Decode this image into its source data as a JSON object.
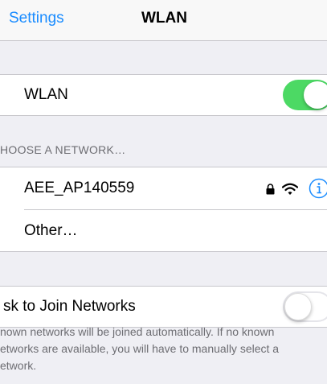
{
  "navbar": {
    "back_label": "Settings",
    "title": "WLAN"
  },
  "wlan_row": {
    "label": "WLAN",
    "toggle_on": true
  },
  "networks_section": {
    "header": "HOOSE A NETWORK…",
    "networks": [
      {
        "name": "AEE_AP140559",
        "secured": true,
        "signal": "full"
      }
    ],
    "other_label": "Other…"
  },
  "ask_row": {
    "label": "sk to Join Networks",
    "toggle_on": false
  },
  "footer": {
    "lines": [
      "nown networks will be joined automatically. If no known",
      "etworks are available, you will have to manually select a",
      "etwork."
    ]
  },
  "colors": {
    "accent": "#1a8cff",
    "toggle_on": "#4cd964",
    "background": "#efeff4"
  },
  "icons": [
    "lock-icon",
    "wifi-icon",
    "info-icon"
  ]
}
